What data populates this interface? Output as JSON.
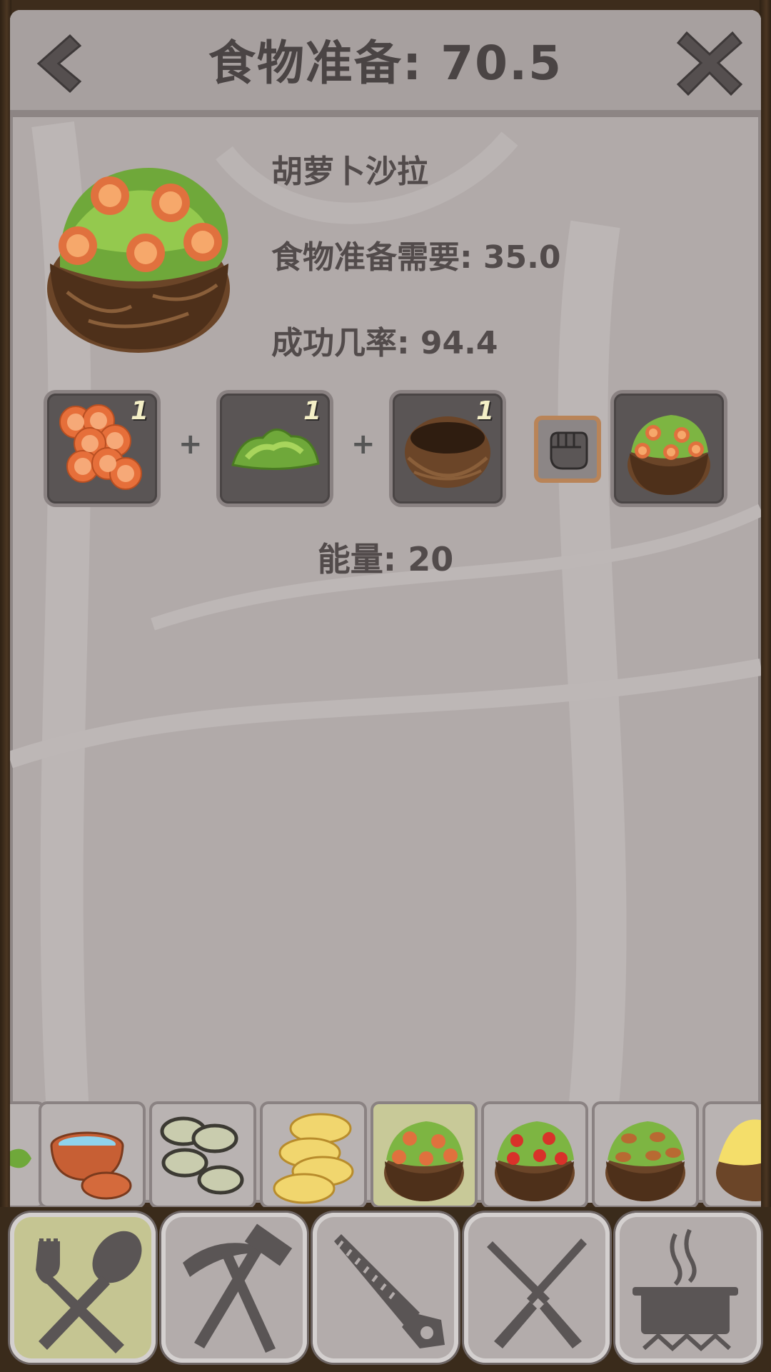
{
  "header": {
    "title": "食物准备: 70.5",
    "back_icon": "chevron-left-icon",
    "close_icon": "close-x-icon"
  },
  "recipe": {
    "name": "胡萝卜沙拉",
    "requirement_line": "食物准备需要: 35.0",
    "success_line": "成功几率: 94.4",
    "ingredients": [
      {
        "icon": "carrot-slices-icon",
        "count": "1"
      },
      {
        "icon": "lettuce-icon",
        "count": "1"
      },
      {
        "icon": "coconut-bowl-icon",
        "count": "1"
      }
    ],
    "plus": "+",
    "craft_icon": "fist-icon",
    "result_icon": "carrot-salad-icon",
    "energy_line": "能量: 20"
  },
  "tray": {
    "items": [
      {
        "icon": "herb-partial-icon"
      },
      {
        "icon": "clay-pot-water-icon"
      },
      {
        "icon": "cucumber-slices-icon"
      },
      {
        "icon": "potato-slices-icon"
      },
      {
        "icon": "carrot-salad-icon",
        "selected": true
      },
      {
        "icon": "tomato-salad-icon"
      },
      {
        "icon": "walnut-salad-icon"
      },
      {
        "icon": "mashed-potato-icon"
      }
    ]
  },
  "tools": [
    {
      "icon": "fork-spoon-icon",
      "selected": true
    },
    {
      "icon": "pickaxe-hammer-icon"
    },
    {
      "icon": "saw-icon"
    },
    {
      "icon": "crossed-knives-icon"
    },
    {
      "icon": "cooking-pot-icon"
    }
  ],
  "colors": {
    "panel_bg": "#b1aaa9",
    "text": "#4a4444",
    "slot_bg": "#5a5555",
    "selected_tint": "#c8c998",
    "count_text": "#f4efc6"
  }
}
